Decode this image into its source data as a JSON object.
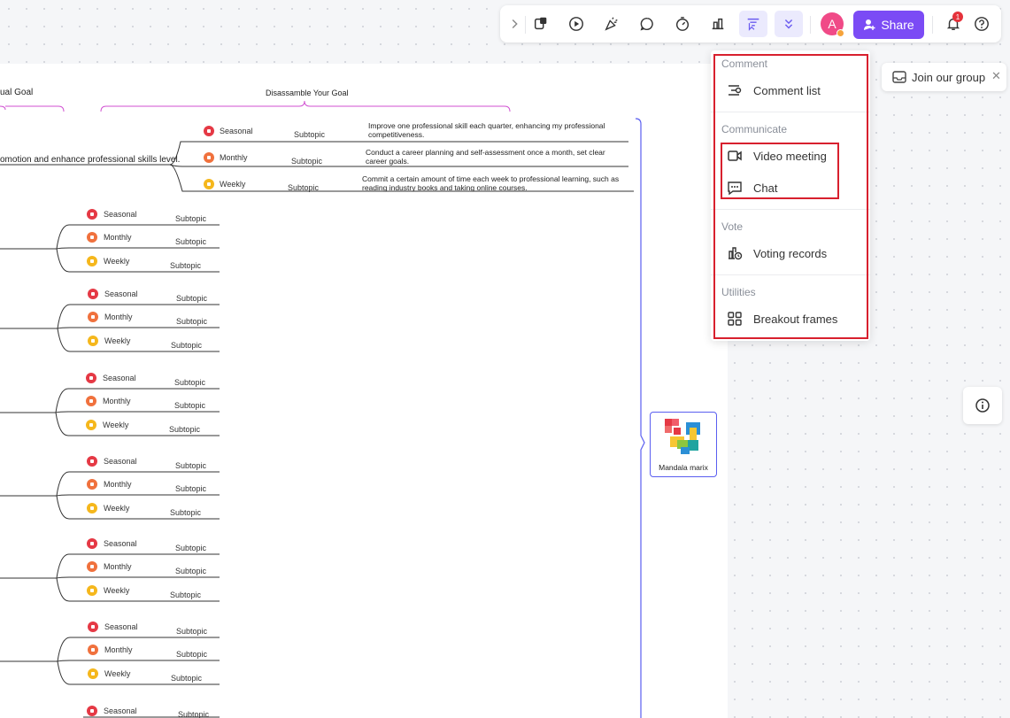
{
  "toolbar": {
    "expand_icon": "chevron-right-icon",
    "icons": [
      "sticker-icon",
      "play-icon",
      "celebrate-icon",
      "comment-icon",
      "timer-icon",
      "vote-icon",
      "collaboration-icon",
      "more-icon"
    ],
    "avatar_initial": "A",
    "share_label": "Share",
    "notification_count": "1",
    "accent_color": "#7b4bf5"
  },
  "menu": {
    "sections": [
      {
        "title": "Comment",
        "items": [
          {
            "label": "Comment list",
            "icon": "comment-list-icon"
          }
        ]
      },
      {
        "title": "Communicate",
        "items": [
          {
            "label": "Video meeting",
            "icon": "video-icon"
          },
          {
            "label": "Chat",
            "icon": "chat-icon"
          }
        ]
      },
      {
        "title": "Vote",
        "items": [
          {
            "label": "Voting records",
            "icon": "voting-records-icon"
          }
        ]
      },
      {
        "title": "Utilities",
        "items": [
          {
            "label": "Breakout frames",
            "icon": "breakout-frames-icon"
          }
        ]
      }
    ]
  },
  "join_group": {
    "label": "Join our group",
    "close": "✕"
  },
  "mindmap": {
    "header_left": "ual Goal",
    "header_right": "Disassamble Your Goal",
    "main_branch_text": "omotion and enhance professional skills level.",
    "first_group": [
      {
        "flag": "Seasonal",
        "sub": "Subtopic",
        "desc": "Improve one professional skill each quarter, enhancing my professional competitiveness."
      },
      {
        "flag": "Monthly",
        "sub": "Subtopic",
        "desc": "Conduct a career planning and self-assessment once a month, set clear career goals."
      },
      {
        "flag": "Weekly",
        "sub": "Subtopic",
        "desc": "Commit a certain amount of time each week to professional learning, such as reading industry books and taking online courses."
      }
    ],
    "group_labels": [
      "Seasonal",
      "Monthly",
      "Weekly"
    ],
    "subtopic_label": "Subtopic",
    "last_group_label": "Seasonal"
  },
  "mandala": {
    "label": "Mandala marix"
  }
}
